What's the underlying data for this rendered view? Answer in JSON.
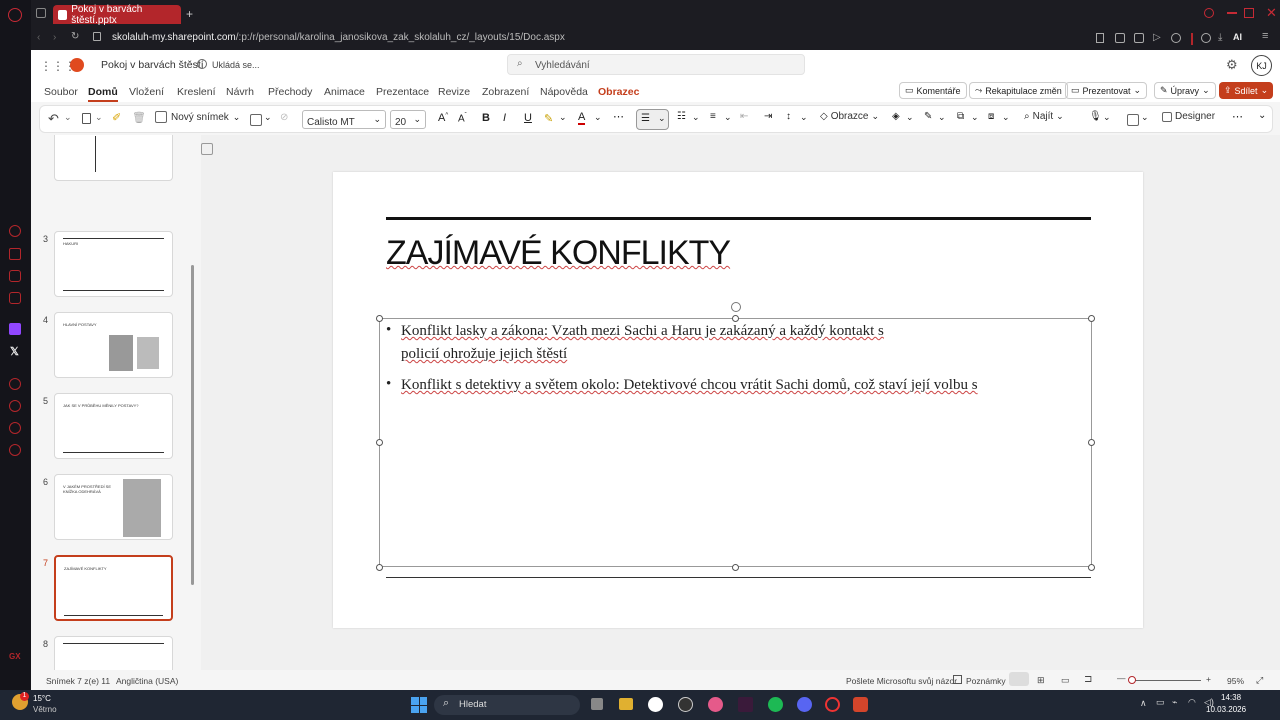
{
  "browser": {
    "tab_title": "Pokoj v barvách štěstí.pptx",
    "url_host": "skolaluh-my.sharepoint.com",
    "url_path": "/:p:/r/personal/karolina_janosikova_zak_skolaluh_cz/_layouts/15/Doc.aspx",
    "new_tab": "+"
  },
  "app": {
    "doc_title": "Pokoj v barvách štěstí",
    "save_status": "Ukládá se...",
    "search_placeholder": "Vyhledávání",
    "user_initials": "KJ"
  },
  "ribbon_tabs": [
    "Soubor",
    "Domů",
    "Vložení",
    "Kreslení",
    "Návrh",
    "Přechody",
    "Animace",
    "Prezentace",
    "Revize",
    "Zobrazení",
    "Nápověda",
    "Obrazec"
  ],
  "ribbon_right": {
    "comments": "Komentáře",
    "recap": "Rekapitulace změn",
    "present": "Prezentovat",
    "edit": "Úpravy",
    "share": "Sdílet"
  },
  "toolbar": {
    "new_slide": "Nový snímek",
    "font_name": "Calisto MT",
    "font_size": "20",
    "shapes": "Obrazce",
    "find": "Najít",
    "designer": "Designer"
  },
  "thumbnails": [
    {
      "num": "",
      "title": ""
    },
    {
      "num": "3",
      "title": "HAKURI"
    },
    {
      "num": "4",
      "title": "HLAVNÍ POSTAVY"
    },
    {
      "num": "5",
      "title": "JAK SE V PRŮBĚHU MĚNILY POSTAVY?"
    },
    {
      "num": "6",
      "title": "V JAKÉM PROSTŘEDÍ SE KNÍŽKA ODEHRÁVÁ"
    },
    {
      "num": "7",
      "title": "ZAJÍMAVÉ KONFLIKTY"
    },
    {
      "num": "8",
      "title": ""
    }
  ],
  "slide": {
    "title": "ZAJÍMAVÉ KONFLIKTY",
    "bullet1_line1": "Konflikt lasky a zákona: Vzath mezi Sachi a Haru je zakázaný a každý kontakt s",
    "bullet1_line2": "policií ohrožuje jejich štěstí",
    "bullet2": "Konflikt s detektivy a světem okolo: Detektivové chcou vrátit Sachi domů, což staví její volbu s"
  },
  "status": {
    "slide_info": "Snímek 7 z(e) 11",
    "language": "Angličtina (USA)",
    "feedback": "Pošlete Microsoftu svůj názor",
    "notes": "Poznámky",
    "zoom": "95%"
  },
  "taskbar": {
    "weather_temp": "15°C",
    "weather_desc": "Větrno",
    "search": "Hledat",
    "time": "14:38",
    "date": "10.03.2026"
  },
  "colors": {
    "accent": "#c43e1c",
    "browser_tab": "#b3262b"
  }
}
